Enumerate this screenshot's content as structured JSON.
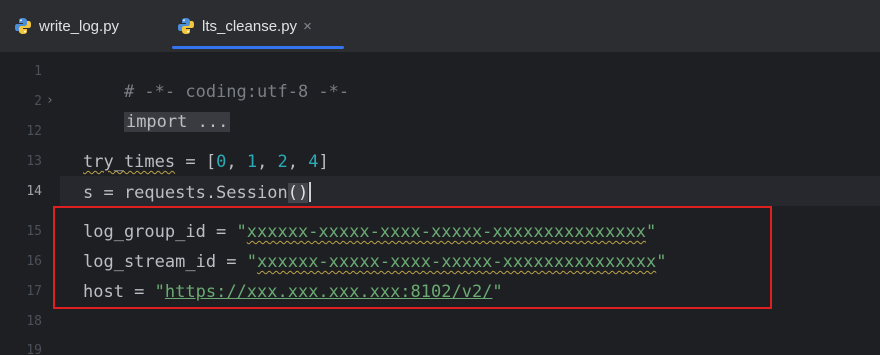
{
  "tabs": [
    {
      "label": "write_log.py",
      "icon": "python-icon",
      "active": false
    },
    {
      "label": "lts_cleanse.py",
      "icon": "python-icon",
      "active": true,
      "close_glyph": "×"
    }
  ],
  "colors": {
    "accent": "#3574f0",
    "highlight_box": "#e02020",
    "string": "#6aab73",
    "number": "#2aacb8"
  },
  "gutter": {
    "line_numbers": [
      "1",
      "2",
      "12",
      "13",
      "14",
      "15",
      "16",
      "17",
      "18",
      "19"
    ],
    "fold_glyph": "›"
  },
  "code": {
    "line1": "# -*- coding:utf-8 -*-",
    "line2_fold": "import ...",
    "line13_var": "try_times",
    "line13_eq": " = [",
    "line13_n0": "0",
    "line13_n1": "1",
    "line13_n2": "2",
    "line13_n4": "4",
    "line14_text": "s = requests.Session",
    "line14_parens": "()",
    "line15_var": "log_group_id = ",
    "line15_val": "xxxxxx-xxxxx-xxxx-xxxxx-xxxxxxxxxxxxxxx",
    "line16_var": "log_stream_id = ",
    "line16_val": "xxxxxx-xxxxx-xxxx-xxxxx-xxxxxxxxxxxxxxx",
    "line17_var": "host = ",
    "line17_val": "https://xxx.xxx.xxx.xxx:8102/v2/"
  }
}
